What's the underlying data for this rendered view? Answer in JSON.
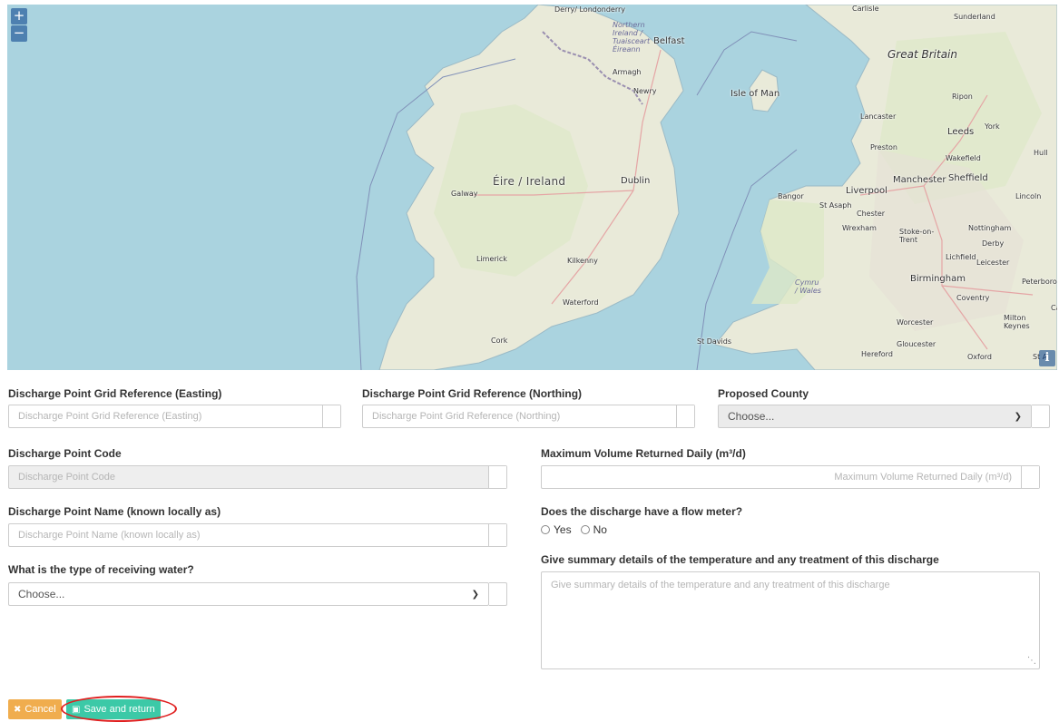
{
  "map": {
    "zoom_in": "+",
    "zoom_out": "−",
    "info": "i",
    "places": {
      "derry": "Derry/\nLondonderry",
      "northern_ireland": "Northern Ireland / Tuaisceart Éireann",
      "belfast": "Belfast",
      "armagh": "Armagh",
      "newry": "Newry",
      "isle_of_man": "Isle of Man",
      "carlisle": "Carlisle",
      "sunderland": "Sunderland",
      "great_britain": "Great Britain",
      "ripon": "Ripon",
      "lancaster": "Lancaster",
      "york": "York",
      "leeds": "Leeds",
      "preston": "Preston",
      "hull": "Hull",
      "wakefield": "Wakefield",
      "manchester": "Manchester",
      "sheffield": "Sheffield",
      "liverpool": "Liverpool",
      "bangor": "Bangor",
      "st_asaph": "St Asaph",
      "chester": "Chester",
      "lincoln": "Lincoln",
      "wrexham": "Wrexham",
      "stoke": "Stoke-on-Trent",
      "nottingham": "Nottingham",
      "derby": "Derby",
      "lichfield": "Lichfield",
      "leicester": "Leicester",
      "birmingham": "Birmingham",
      "peterborough": "Peterboro",
      "cymru": "Cymru / Wales",
      "coventry": "Coventry",
      "worcester": "Worcester",
      "milton_keynes": "Milton Keynes",
      "hereford": "Hereford",
      "gloucester": "Gloucester",
      "oxford": "Oxford",
      "st_albans": "St A",
      "st_davids": "St Davids",
      "eire": "Éire / Ireland",
      "dublin": "Dublin",
      "galway": "Galway",
      "limerick": "Limerick",
      "kilkenny": "Kilkenny",
      "waterford": "Waterford",
      "cork": "Cork",
      "cambridge_edge": "Ca"
    }
  },
  "form": {
    "easting": {
      "label": "Discharge Point Grid Reference (Easting)",
      "placeholder": "Discharge Point Grid Reference (Easting)"
    },
    "northing": {
      "label": "Discharge Point Grid Reference (Northing)",
      "placeholder": "Discharge Point Grid Reference (Northing)"
    },
    "county": {
      "label": "Proposed County",
      "value": "Choose..."
    },
    "code": {
      "label": "Discharge Point Code",
      "placeholder": "Discharge Point Code"
    },
    "max_volume": {
      "label": "Maximum Volume Returned Daily (m³/d)",
      "placeholder": "Maximum Volume Returned Daily (m³/d)"
    },
    "name": {
      "label": "Discharge Point Name (known locally as)",
      "placeholder": "Discharge Point Name (known locally as)"
    },
    "flow_meter": {
      "label": "Does the discharge have a flow meter?",
      "yes": "Yes",
      "no": "No"
    },
    "receiving_water": {
      "label": "What is the type of receiving water?",
      "value": "Choose..."
    },
    "summary": {
      "label": "Give summary details of the temperature and any treatment of this discharge",
      "placeholder": "Give summary details of the temperature and any treatment of this discharge"
    }
  },
  "buttons": {
    "cancel": "Cancel",
    "save": "Save and return"
  },
  "colors": {
    "sea": "#aad3df",
    "land": "#f2efe9",
    "cancel": "#f0ad4e",
    "save": "#3cc9a7",
    "highlight": "#e02020"
  },
  "icons": {
    "cancel": "times-icon",
    "save": "floppy-disk-icon",
    "select": "chevron-down-icon",
    "info": "info-icon"
  }
}
